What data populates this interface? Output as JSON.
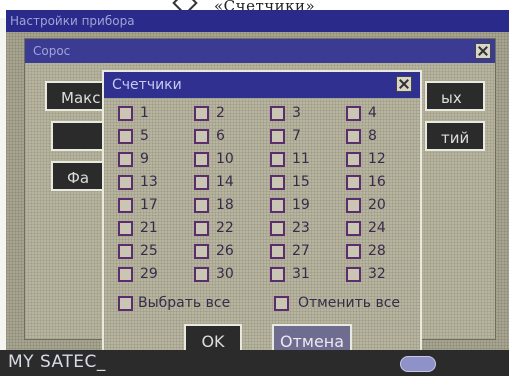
{
  "caption": {
    "text": "«Счетчики»"
  },
  "background_window": {
    "title": "Настройки прибора",
    "subtitle": "Сорос",
    "buttons": [
      {
        "label": "Макс"
      },
      {
        "label": "ых"
      },
      {
        "label": "тий"
      },
      {
        "label": "Фа"
      }
    ]
  },
  "dialog": {
    "title": "Счетчики",
    "counters": [
      {
        "label": "1"
      },
      {
        "label": "2"
      },
      {
        "label": "3"
      },
      {
        "label": "4"
      },
      {
        "label": "5"
      },
      {
        "label": "6"
      },
      {
        "label": "7"
      },
      {
        "label": "8"
      },
      {
        "label": "9"
      },
      {
        "label": "10"
      },
      {
        "label": "11"
      },
      {
        "label": "12"
      },
      {
        "label": "13"
      },
      {
        "label": "14"
      },
      {
        "label": "15"
      },
      {
        "label": "16"
      },
      {
        "label": "17"
      },
      {
        "label": "18"
      },
      {
        "label": "19"
      },
      {
        "label": "20"
      },
      {
        "label": "21"
      },
      {
        "label": "22"
      },
      {
        "label": "23"
      },
      {
        "label": "24"
      },
      {
        "label": "25"
      },
      {
        "label": "26"
      },
      {
        "label": "27"
      },
      {
        "label": "28"
      },
      {
        "label": "29"
      },
      {
        "label": "30"
      },
      {
        "label": "31"
      },
      {
        "label": "32"
      }
    ],
    "select_all_label": "Выбрать все",
    "deselect_all_label": "Отменить все",
    "ok_label": "OK",
    "cancel_label": "Отмена"
  },
  "status_bar": {
    "label": "MY SATEC_"
  }
}
